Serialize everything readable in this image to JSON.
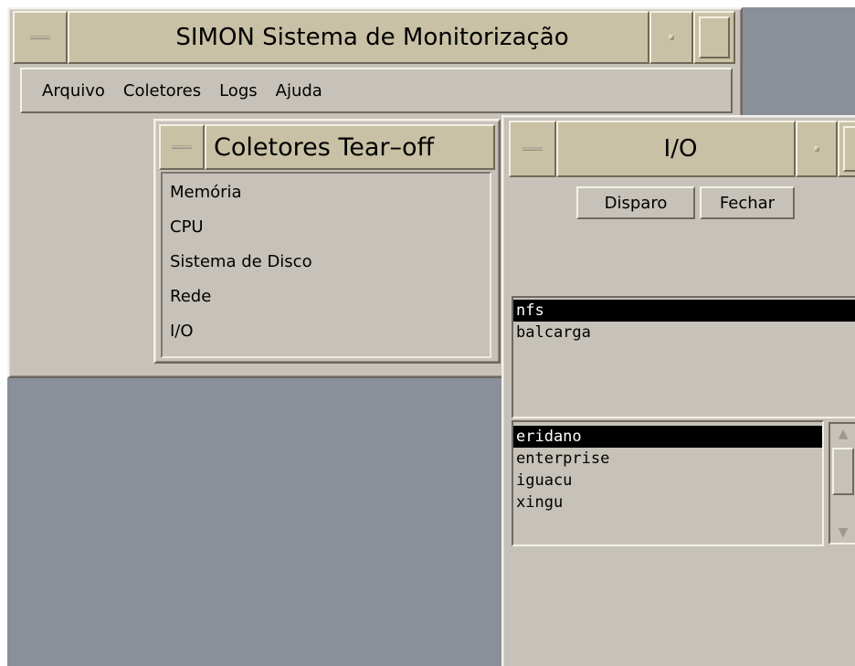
{
  "main_window": {
    "title": "SIMON Sistema de Monitorização",
    "menu": [
      "Arquivo",
      "Coletores",
      "Logs",
      "Ajuda"
    ]
  },
  "tearoff_window": {
    "title": "Coletores Tear–off",
    "items": [
      "Memória",
      "CPU",
      "Sistema de Disco",
      "Rede",
      "I/O"
    ]
  },
  "io_window": {
    "title": "I/O",
    "buttons": {
      "trigger": "Disparo",
      "close": "Fechar"
    },
    "list1": {
      "items": [
        "nfs",
        "balcarga"
      ],
      "selected": "nfs"
    },
    "list2": {
      "items": [
        "eridano",
        "enterprise",
        "iguacu",
        "xingu"
      ],
      "selected": "eridano"
    }
  },
  "icons": [
    "window-menu-icon",
    "minimize-icon",
    "maximize-icon",
    "scroll-up-arrow-icon",
    "scroll-down-arrow-icon"
  ],
  "colors": {
    "desktop": "#8a909a",
    "window_bg": "#c6c2b9",
    "titlebar": "#c8c1a5",
    "selection": "#000000"
  }
}
